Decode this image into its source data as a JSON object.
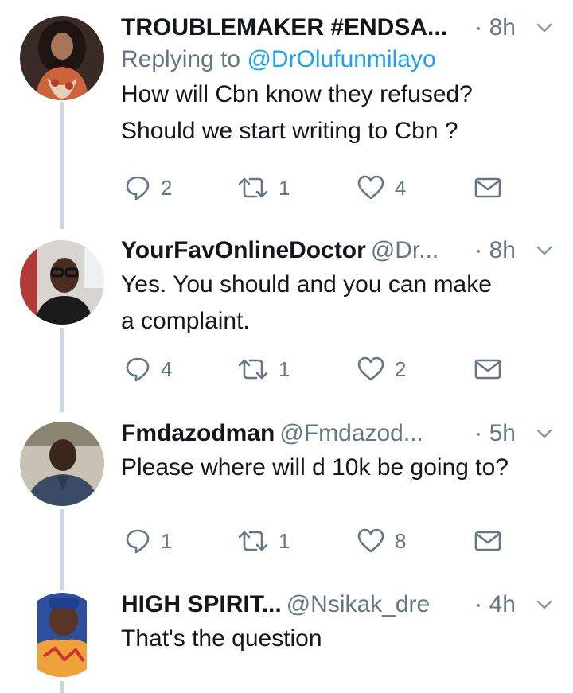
{
  "tweets": [
    {
      "name": "TROUBLEMAKER #ENDSA...",
      "handle": "",
      "time": "· 8h",
      "replying_label": "Replying to",
      "replying_handle": "@DrOlufunmilayo",
      "lines": [
        "How will Cbn know they refused?",
        "Should we start writing to Cbn ?"
      ],
      "replies": "2",
      "retweets": "1",
      "likes": "4"
    },
    {
      "name": "YourFavOnlineDoctor",
      "handle": "@Dr...",
      "time": "· 8h",
      "lines": [
        "Yes. You should and you can make",
        "a complaint."
      ],
      "replies": "4",
      "retweets": "1",
      "likes": "2"
    },
    {
      "name": "Fmdazodman",
      "handle": "@Fmdazod...",
      "time": "· 5h",
      "lines": [
        "Please where will d 10k be going to?"
      ],
      "replies": "1",
      "retweets": "1",
      "likes": "8"
    },
    {
      "name": "HIGH SPIRIT...",
      "handle": "@Nsikak_dre",
      "time": "· 4h",
      "lines": [
        "That's the question"
      ]
    }
  ],
  "icons": {
    "reply": "reply-icon",
    "retweet": "retweet-icon",
    "like": "heart-icon",
    "dm": "envelope-icon",
    "menu": "chevron-down-icon"
  },
  "colors": {
    "text": "#14171a",
    "secondary": "#657786",
    "link": "#1da1f2",
    "thread_line": "#ccd6dd"
  }
}
